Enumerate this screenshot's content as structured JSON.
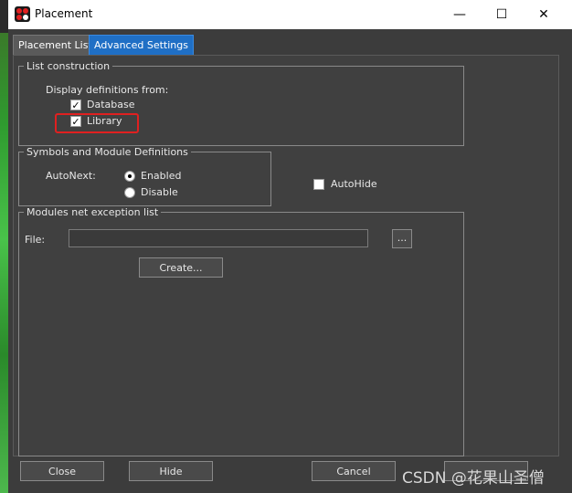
{
  "window": {
    "title": "Placement",
    "minimize_glyph": "—",
    "maximize_glyph": "☐",
    "close_glyph": "✕"
  },
  "tabs": [
    {
      "label": "Placement List",
      "active": false
    },
    {
      "label": "Advanced Settings",
      "active": true
    }
  ],
  "list_construction": {
    "title": "List construction",
    "display_label": "Display definitions from:",
    "database": {
      "label": "Database",
      "checked": true
    },
    "library": {
      "label": "Library",
      "checked": true
    }
  },
  "symbols": {
    "title": "Symbols and Module Definitions",
    "autonext_label": "AutoNext:",
    "options": [
      {
        "label": "Enabled",
        "selected": true
      },
      {
        "label": "Disable",
        "selected": false
      }
    ]
  },
  "autohide": {
    "label": "AutoHide",
    "checked": false
  },
  "modules": {
    "title": "Modules net exception list",
    "file_label": "File:",
    "file_value": "",
    "browse_label": "...",
    "create_label": "Create..."
  },
  "footer": {
    "close_label": "Close",
    "hide_label": "Hide",
    "cancel_label": "Cancel"
  },
  "watermark": "CSDN @花果山圣僧",
  "colors": {
    "accent_tab": "#1f6fc5",
    "highlight_box": "#e02020"
  }
}
